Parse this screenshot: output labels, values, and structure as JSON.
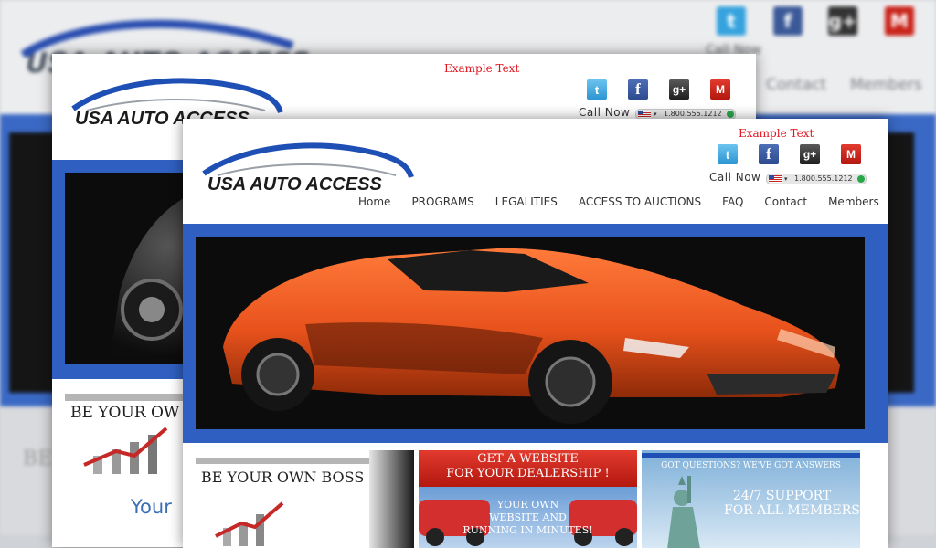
{
  "site": {
    "logo": "USA AUTO ACCESS"
  },
  "top_text": "Example Text",
  "social": [
    {
      "name": "twitter",
      "glyph": "t",
      "color": "#2b95d3"
    },
    {
      "name": "facebook",
      "glyph": "f",
      "color": "#3b5998"
    },
    {
      "name": "google-plus",
      "glyph": "g+",
      "color": "#2a2a2a"
    },
    {
      "name": "gmail",
      "glyph": "M",
      "color": "#c9241a"
    }
  ],
  "contact": {
    "call_label": "Call Now",
    "phone": "1.800.555.1212"
  },
  "nav": [
    "Home",
    "PROGRAMS",
    "LEGALITIES",
    "ACCESS TO AUCTIONS",
    "FAQ",
    "Contact",
    "Members"
  ],
  "promos": {
    "boss": "BE YOUR OWN BOSS",
    "boss_partial": "BE YOUR OW",
    "website_1": "GET A WEBSITE",
    "website_2": "FOR YOUR DEALERSHIP !",
    "website_3": "YOUR OWN",
    "website_4": "WEBSITE AND",
    "website_5": "RUNNING IN MINUTES!",
    "questions": "GOT QUESTIONS? WE'VE GOT ANSWERS",
    "support_1": "24/7 SUPPORT",
    "support_2": "FOR ALL MEMBERS",
    "your_partial": "Your"
  },
  "colors": {
    "accent_blue": "#2f5fc0",
    "example_red": "#e0141e",
    "car_orange": "#e8521c"
  }
}
